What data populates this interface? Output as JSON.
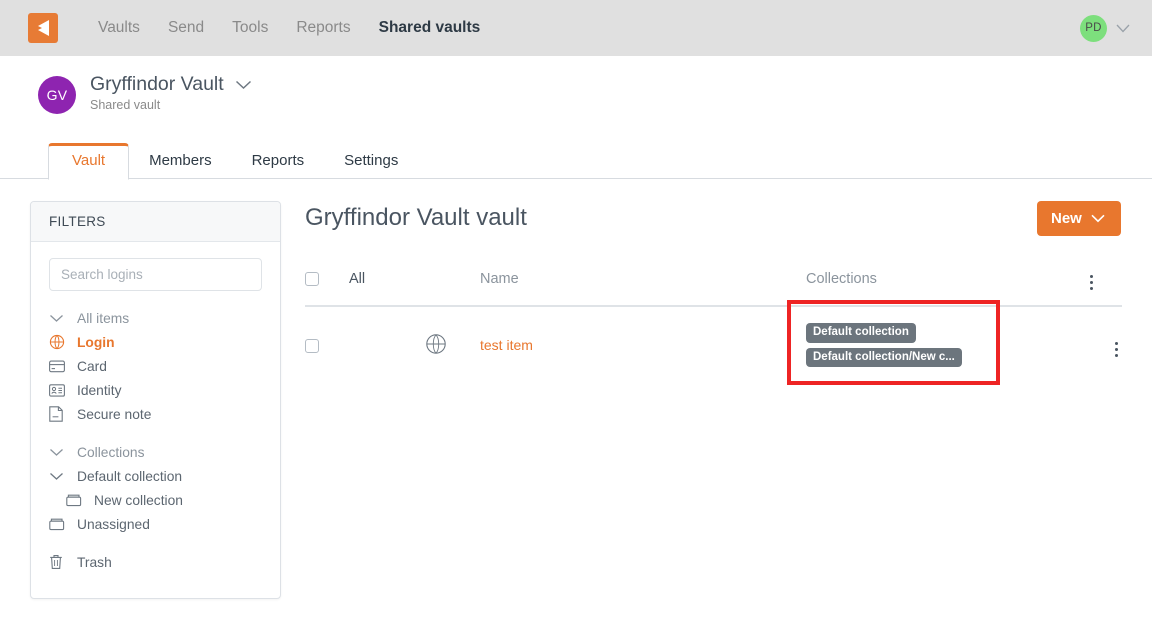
{
  "topnav": {
    "logo_icon": "bitwarden-shield-icon",
    "links": [
      {
        "label": "Vaults",
        "active": false
      },
      {
        "label": "Send",
        "active": false
      },
      {
        "label": "Tools",
        "active": false
      },
      {
        "label": "Reports",
        "active": false
      },
      {
        "label": "Shared vaults",
        "active": true
      }
    ],
    "user": {
      "initials": "PD",
      "avatar_color": "#7ddf7d",
      "chevron_icon": "chevron-down-icon"
    }
  },
  "vault_header": {
    "initials": "GV",
    "avatar_color": "#8e24b0",
    "title": "Gryffindor Vault",
    "subtitle": "Shared vault",
    "chevron_icon": "chevron-down-icon"
  },
  "tabs": [
    {
      "label": "Vault",
      "active": true
    },
    {
      "label": "Members",
      "active": false
    },
    {
      "label": "Reports",
      "active": false
    },
    {
      "label": "Settings",
      "active": false
    }
  ],
  "sidebar": {
    "heading": "FILTERS",
    "search": {
      "value": "",
      "placeholder": "Search logins"
    },
    "types": [
      {
        "label": "All items",
        "icon": "chevron-down-icon",
        "state": "muted"
      },
      {
        "label": "Login",
        "icon": "globe-icon",
        "state": "accent"
      },
      {
        "label": "Card",
        "icon": "credit-card-icon",
        "state": "normal"
      },
      {
        "label": "Identity",
        "icon": "id-card-icon",
        "state": "normal"
      },
      {
        "label": "Secure note",
        "icon": "note-icon",
        "state": "normal"
      }
    ],
    "collections": [
      {
        "label": "Collections",
        "icon": "chevron-down-icon",
        "state": "muted",
        "indent": false
      },
      {
        "label": "Default collection",
        "icon": "chevron-down-icon",
        "state": "normal",
        "indent": false
      },
      {
        "label": "New collection",
        "icon": "folder-icon",
        "state": "normal",
        "indent": true
      },
      {
        "label": "Unassigned",
        "icon": "folder-icon",
        "state": "normal",
        "indent": false
      }
    ],
    "trash": {
      "label": "Trash",
      "icon": "trash-icon"
    }
  },
  "main": {
    "title": "Gryffindor Vault vault",
    "new_button": {
      "label": "New",
      "icon": "chevron-down-icon",
      "color": "#e8772e"
    },
    "table": {
      "headers": {
        "all": "All",
        "name": "Name",
        "collections": "Collections",
        "options_icon": "kebab-menu-icon"
      },
      "rows": [
        {
          "checked": false,
          "item_icon": "globe-icon",
          "name": "test item",
          "collections": [
            "Default collection",
            "Default collection/New c..."
          ],
          "row_menu_icon": "kebab-menu-icon"
        }
      ]
    }
  },
  "annotation": {
    "type": "highlight-rectangle",
    "color": "#ee2424",
    "target": "collections-cell"
  }
}
